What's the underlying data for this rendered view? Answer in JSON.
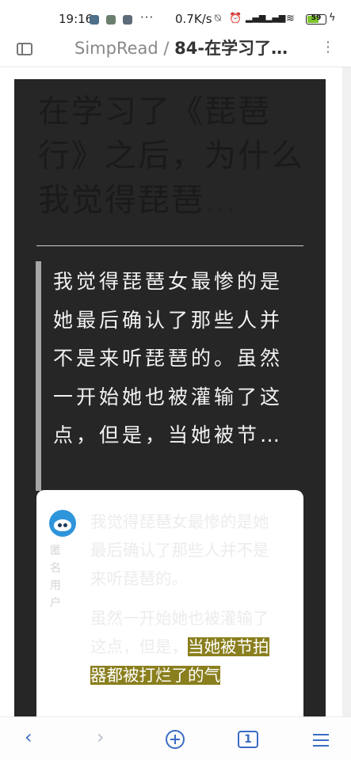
{
  "status_bar": {
    "time": "19:16",
    "more": "···",
    "net_speed": "0.7K/s",
    "battery": "59"
  },
  "title_bar": {
    "app_name": "SimpRead",
    "separator": " / ",
    "doc_title": "84-在学习了…",
    "menu_glyph": "⋮"
  },
  "article": {
    "heading": "在学习了《琵琶行》之后，为什么我觉得琵琶…",
    "quote": "我觉得琵琶女最惨的是她最后确认了那些人并不是来听琵琶的。虽然一开始她也被灌输了这点，但是，当她被节…"
  },
  "answer": {
    "author": "匿名用户",
    "paragraph1": "我觉得琵琶女最惨的是她最后确认了那些人并不是来听琵琶的。",
    "paragraph2_plain": "虽然一开始她也被灌输了这点，但是，",
    "paragraph2_highlight": "当她被节拍器都被打烂了的气"
  },
  "bottom_nav": {
    "back": "‹",
    "forward": "›",
    "tab_count": "1"
  },
  "colors": {
    "article_bg": "#262626",
    "highlight": "#8a7f1e",
    "accent": "#3a6cc4",
    "battery_fill": "#7ec52e"
  },
  "icons": [
    "alarm-off-icon",
    "alarm-icon",
    "signal-icon",
    "wifi-icon",
    "battery-icon",
    "charging-icon",
    "sidebar-toggle-icon",
    "more-vert-icon",
    "back-icon",
    "forward-icon",
    "new-tab-icon",
    "tabs-icon",
    "menu-icon"
  ]
}
